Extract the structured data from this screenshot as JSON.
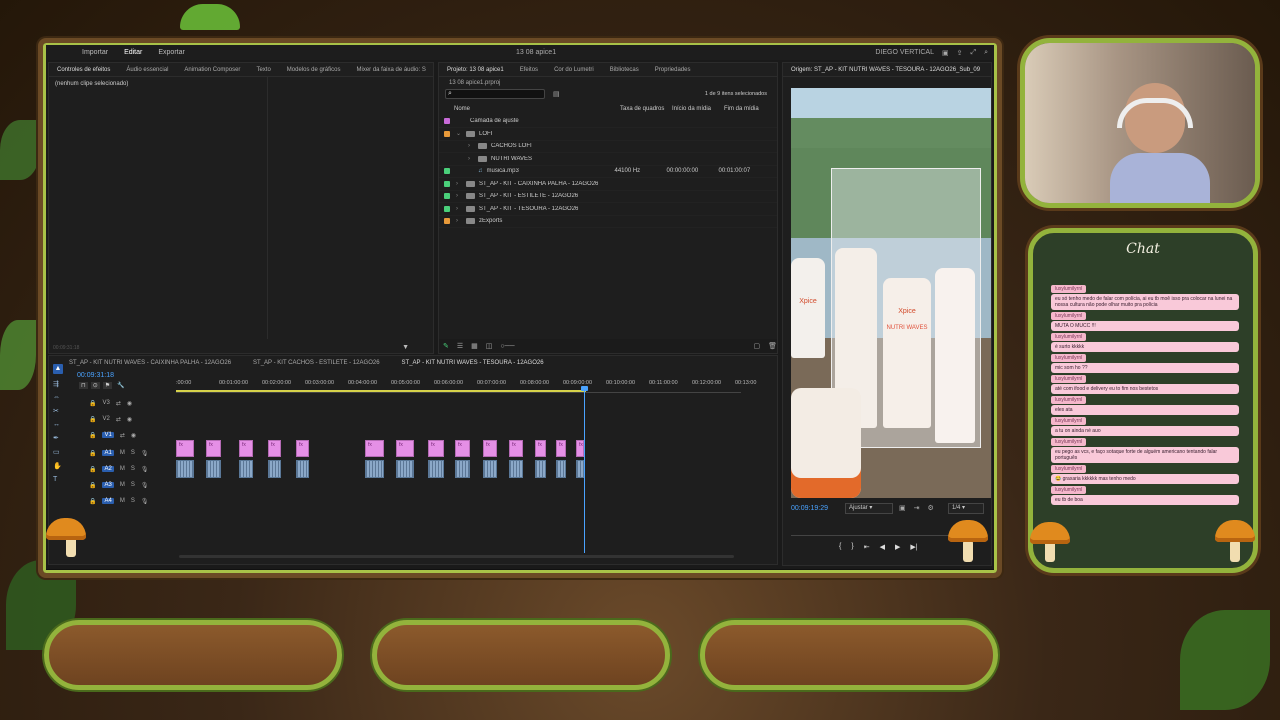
{
  "topbar": {
    "menu": [
      "Importar",
      "Editar",
      "Exportar"
    ],
    "active": "Editar",
    "project_title": "13 08 apice1",
    "workspace": "DIEGO VERTICAL"
  },
  "effect_controls": {
    "tabs": [
      "Controles de efeitos",
      "Áudio essencial",
      "Animation Composer",
      "Texto",
      "Modelos de gráficos",
      "Mixer da faixa de áudio: S"
    ],
    "empty_msg": "(nenhum clipe selecionado)",
    "timecode": "00:09:31:18"
  },
  "project": {
    "tabs": [
      "Projeto: 13 08 apice1",
      "Efeitos",
      "Cor do Lumetri",
      "Bibliotecas",
      "Propriedades"
    ],
    "file": "13 08 apice1.prproj",
    "search_placeholder": "",
    "count": "1 de 9 itens selecionados",
    "columns": [
      "Nome",
      "Taxa de quadros",
      "Início da mídia",
      "Fim da mídia"
    ],
    "items": [
      {
        "name": "Camada de ajuste",
        "color": "#c86ad8",
        "type": "item",
        "indent": 0,
        "rate": "",
        "start": "",
        "end": ""
      },
      {
        "name": "LOFI",
        "color": "#e89a3a",
        "type": "folder-open",
        "indent": 0,
        "rate": "",
        "start": "",
        "end": ""
      },
      {
        "name": "CACHOS LOFI",
        "color": "",
        "type": "folder",
        "indent": 1,
        "rate": "",
        "start": "",
        "end": ""
      },
      {
        "name": "NUTRI WAVES",
        "color": "",
        "type": "folder",
        "indent": 1,
        "rate": "",
        "start": "",
        "end": ""
      },
      {
        "name": "musica.mp3",
        "color": "#4ad07a",
        "type": "audio",
        "indent": 1,
        "rate": "44100 Hz",
        "start": "00:00:00:00",
        "end": "00:01:00:07"
      },
      {
        "name": "ST_AP - KIT - CAIXINHA PALHA - 12AGO26",
        "color": "#4ad07a",
        "type": "folder",
        "indent": 0,
        "rate": "",
        "start": "",
        "end": ""
      },
      {
        "name": "ST_AP - KIT - ESTILETE - 12AGO26",
        "color": "#4ad07a",
        "type": "folder",
        "indent": 0,
        "rate": "",
        "start": "",
        "end": ""
      },
      {
        "name": "ST_AP - KIT - TESOURA - 12AGO26",
        "color": "#4ad07a",
        "type": "folder",
        "indent": 0,
        "rate": "",
        "start": "",
        "end": ""
      },
      {
        "name": "zExports",
        "color": "#e89a3a",
        "type": "folder",
        "indent": 0,
        "rate": "",
        "start": "",
        "end": ""
      }
    ]
  },
  "source": {
    "title": "Origem: ST_AP - KIT NUTRI WAVES - TESOURA - 12AGO26_Sub_09",
    "timecode": "00:09:19:29",
    "fit": "Ajustar",
    "quality": "1/4",
    "brand_left": "Xpice",
    "brand_mid": "Xpice",
    "product": "NUTRI WAVES"
  },
  "timeline": {
    "tabs": [
      "ST_AP - KIT NUTRI WAVES - CAIXINHA PALHA - 12AGO26",
      "ST_AP - KIT CACHOS - ESTILETE - 12AGO26",
      "ST_AP - KIT NUTRI WAVES - TESOURA - 12AGO26"
    ],
    "timecode": "00:09:31:18",
    "ruler": [
      ":00:00",
      "00:01:00:00",
      "00:02:00:00",
      "00:03:00:00",
      "00:04:00:00",
      "00:05:00:00",
      "00:06:00:00",
      "00:07:00:00",
      "00:08:00:00",
      "00:09:00:00",
      "00:10:00:00",
      "00:11:00:00",
      "00:12:00:00",
      "00:13:00"
    ],
    "video_tracks": [
      "V3",
      "V2",
      "V1"
    ],
    "audio_tracks": [
      "A1",
      "A2",
      "A3",
      "A4"
    ],
    "fx_label": "fx"
  },
  "chat": {
    "title": "Chat",
    "messages": [
      {
        "user": "luxylumilyrnl",
        "text": "eu só tenho medo de falar com polícia, ai eu tb moê isso pra colocar na lunei na nossa cultura não pode olhar muito pra polícia"
      },
      {
        "user": "luxylumilyrnl",
        "text": "MUTA O MUCC !!!"
      },
      {
        "user": "luxylumilyrnl",
        "text": "é surto kkkkk"
      },
      {
        "user": "luxylumilyrnl",
        "text": "mic som ho ??"
      },
      {
        "user": "luxylumilyrnl",
        "text": "até com ifood e delivery eu to fim nos bestetos"
      },
      {
        "user": "luxylumilyrnl",
        "text": "eles ata"
      },
      {
        "user": "luxylumilyrnl",
        "text": "a tu on ainda né auo"
      },
      {
        "user": "luxylumilyrnl",
        "text": "eu pego as vcs, e faço sotaque forte de alguém americano tentando falar português"
      },
      {
        "user": "luxylumilyrnl",
        "text": "😂 graxaria kkkkkk mas tenho medo"
      },
      {
        "user": "luxylumilyrnl",
        "text": "eu tb de boa"
      }
    ]
  }
}
